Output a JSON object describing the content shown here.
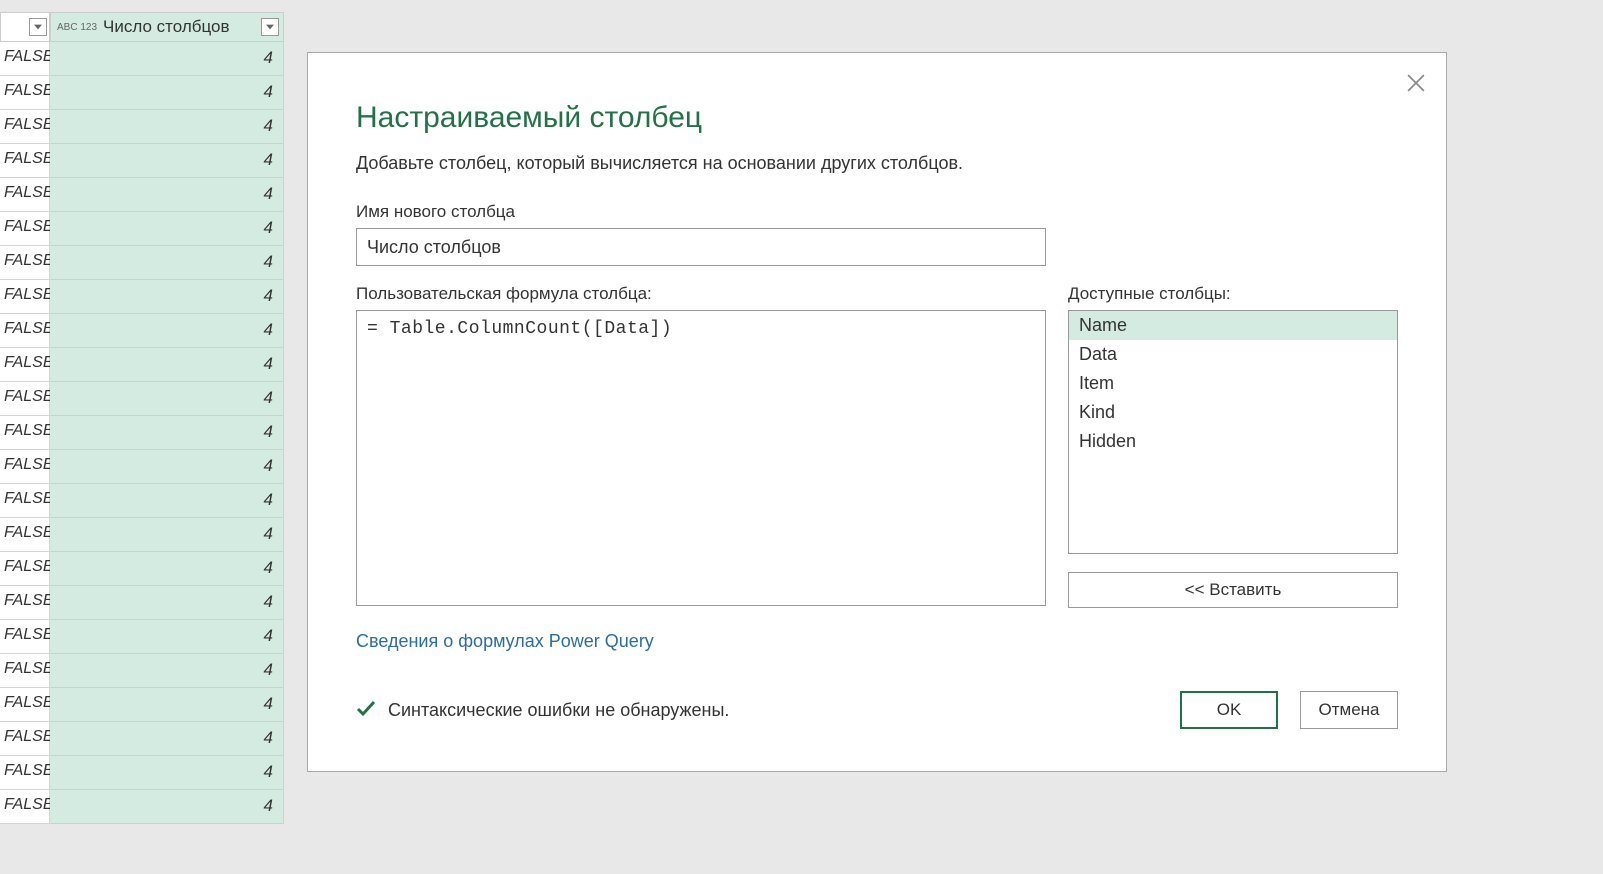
{
  "table": {
    "column_header": "Число столбцов",
    "rows": [
      {
        "c1": "FALSE",
        "c2": "4"
      },
      {
        "c1": "FALSE",
        "c2": "4"
      },
      {
        "c1": "FALSE",
        "c2": "4"
      },
      {
        "c1": "FALSE",
        "c2": "4"
      },
      {
        "c1": "FALSE",
        "c2": "4"
      },
      {
        "c1": "FALSE",
        "c2": "4"
      },
      {
        "c1": "FALSE",
        "c2": "4"
      },
      {
        "c1": "FALSE",
        "c2": "4"
      },
      {
        "c1": "FALSE",
        "c2": "4"
      },
      {
        "c1": "FALSE",
        "c2": "4"
      },
      {
        "c1": "FALSE",
        "c2": "4"
      },
      {
        "c1": "FALSE",
        "c2": "4"
      },
      {
        "c1": "FALSE",
        "c2": "4"
      },
      {
        "c1": "FALSE",
        "c2": "4"
      },
      {
        "c1": "FALSE",
        "c2": "4"
      },
      {
        "c1": "FALSE",
        "c2": "4"
      },
      {
        "c1": "FALSE",
        "c2": "4"
      },
      {
        "c1": "FALSE",
        "c2": "4"
      },
      {
        "c1": "FALSE",
        "c2": "4"
      },
      {
        "c1": "FALSE",
        "c2": "4"
      },
      {
        "c1": "FALSE",
        "c2": "4"
      },
      {
        "c1": "FALSE",
        "c2": "4"
      },
      {
        "c1": "FALSE",
        "c2": "4"
      }
    ],
    "type_label": "ABC\n123"
  },
  "dialog": {
    "title": "Настраиваемый столбец",
    "subtitle": "Добавьте столбец, который вычисляется на основании других столбцов.",
    "name_label": "Имя нового столбца",
    "name_value": "Число столбцов",
    "formula_label": "Пользовательская формула столбца:",
    "formula_value": "= Table.ColumnCount([Data])",
    "available_label": "Доступные столбцы:",
    "available_columns": [
      "Name",
      "Data",
      "Item",
      "Kind",
      "Hidden"
    ],
    "insert_label": "<< Вставить",
    "help_link": "Сведения о формулах Power Query",
    "status_text": "Синтаксические ошибки не обнаружены.",
    "ok_label": "OK",
    "cancel_label": "Отмена"
  }
}
